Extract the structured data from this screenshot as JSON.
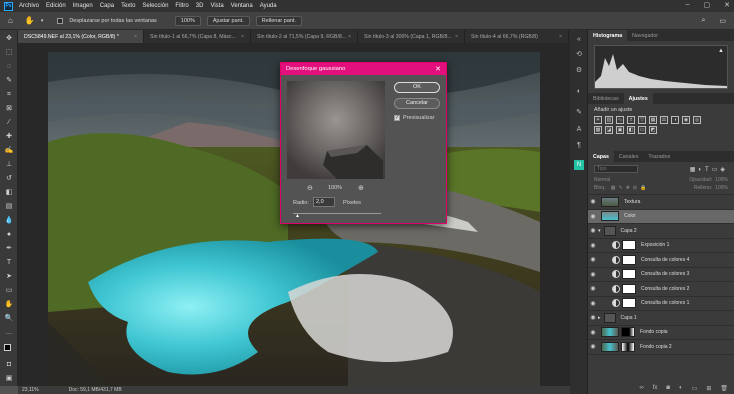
{
  "menubar": {
    "logo": "Ps",
    "items": [
      "Archivo",
      "Edición",
      "Imagen",
      "Capa",
      "Texto",
      "Selección",
      "Filtro",
      "3D",
      "Vista",
      "Ventana",
      "Ayuda"
    ]
  },
  "options": {
    "scroll_all_label": "Desplazarse por todas las ventanas",
    "zoom_100": "100%",
    "fit_screen": "Ajustar pant.",
    "fill_screen": "Rellenar pant."
  },
  "tabs": [
    {
      "label": "DSC5849.NEF al 23,1% (Color, RGB/8) *"
    },
    {
      "label": "Sin título-1 al 66,7% (Capa 8, Másc..."
    },
    {
      "label": "Sin título-2 al 71,5% (Capa 9, RGB/8..."
    },
    {
      "label": "Sin título-3 al 300% (Capa 1, RGB/8..."
    },
    {
      "label": "Sin título-4 al 66,7% (RGB/8)"
    }
  ],
  "status": {
    "zoom": "23,11%",
    "doc": "Doc: 59,1 MB/431,7 MB"
  },
  "panels": {
    "histogram_tabs": [
      "Histograma",
      "Navegador"
    ],
    "adjust_tabs": [
      "Bibliotecas",
      "Ajustes"
    ],
    "add_adjustment": "Añadir un ajuste",
    "layers_tabs": [
      "Capas",
      "Canales",
      "Trazados"
    ],
    "search_placeholder": "Tipo",
    "blend_mode": "Normal",
    "opacity_label": "Opacidad:",
    "opacity_value": "100%",
    "lock_label": "Bloq.:",
    "fill_label": "Relleno:",
    "fill_value": "100%"
  },
  "layers": [
    {
      "name": "Textura",
      "type": "image"
    },
    {
      "name": "Color",
      "type": "image"
    },
    {
      "name": "Capa 2",
      "type": "fill"
    },
    {
      "name": "Exposición 1",
      "type": "adjust"
    },
    {
      "name": "Consulta de colores 4",
      "type": "adjust"
    },
    {
      "name": "Consulta de colores 3",
      "type": "adjust"
    },
    {
      "name": "Consulta de colores 2",
      "type": "adjust"
    },
    {
      "name": "Consulta de colores 1",
      "type": "adjust"
    },
    {
      "name": "Capa 1",
      "type": "fill"
    },
    {
      "name": "Fondo copia",
      "type": "photo"
    },
    {
      "name": "Fondo copia 2",
      "type": "photo"
    }
  ],
  "dialog": {
    "title": "Desenfoque gaussiano",
    "ok": "OK",
    "cancel": "Cancelar",
    "preview_label": "Previsualizar",
    "zoom": "100%",
    "radius_label": "Radio:",
    "radius_value": "2,0",
    "radius_unit": "Píxeles"
  }
}
